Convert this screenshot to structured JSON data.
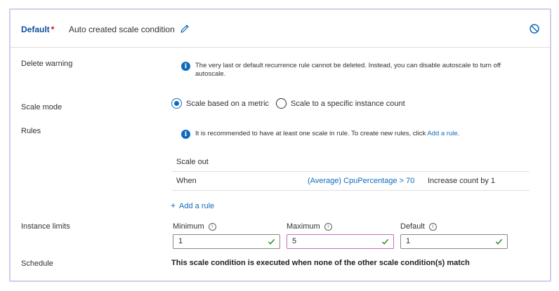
{
  "header": {
    "default_label": "Default",
    "required_mark": "*",
    "condition_name": "Auto created scale condition",
    "edit_icon": "pencil-icon",
    "disable_icon": "disable-icon"
  },
  "delete_warning": {
    "label": "Delete warning",
    "message": "The very last or default recurrence rule cannot be deleted. Instead, you can disable autoscale to turn off autoscale."
  },
  "scale_mode": {
    "label": "Scale mode",
    "options": [
      {
        "label": "Scale based on a metric",
        "selected": true
      },
      {
        "label": "Scale to a specific instance count",
        "selected": false
      }
    ]
  },
  "rules": {
    "label": "Rules",
    "info_text": "It is recommended to have at least one scale in rule. To create new rules, click",
    "info_link": "Add a rule",
    "info_end": ".",
    "table_header": "Scale out",
    "row": {
      "when": "When",
      "condition": "(Average) CpuPercentage > 70",
      "action": "Increase count by 1"
    },
    "add_rule": "Add a rule",
    "add_icon": "+"
  },
  "instance_limits": {
    "label": "Instance limits",
    "fields": [
      {
        "label": "Minimum",
        "value": "1"
      },
      {
        "label": "Maximum",
        "value": "5"
      },
      {
        "label": "Default",
        "value": "1"
      }
    ]
  },
  "schedule": {
    "label": "Schedule",
    "text": "This scale condition is executed when none of the other scale condition(s) match"
  },
  "colors": {
    "accent": "#0f6cbd",
    "title": "#0f4f9e",
    "required": "#c50f1f",
    "valid_check": "#107c10",
    "focus_border": "#c76bbe",
    "panel_border": "#cfcdf0"
  }
}
